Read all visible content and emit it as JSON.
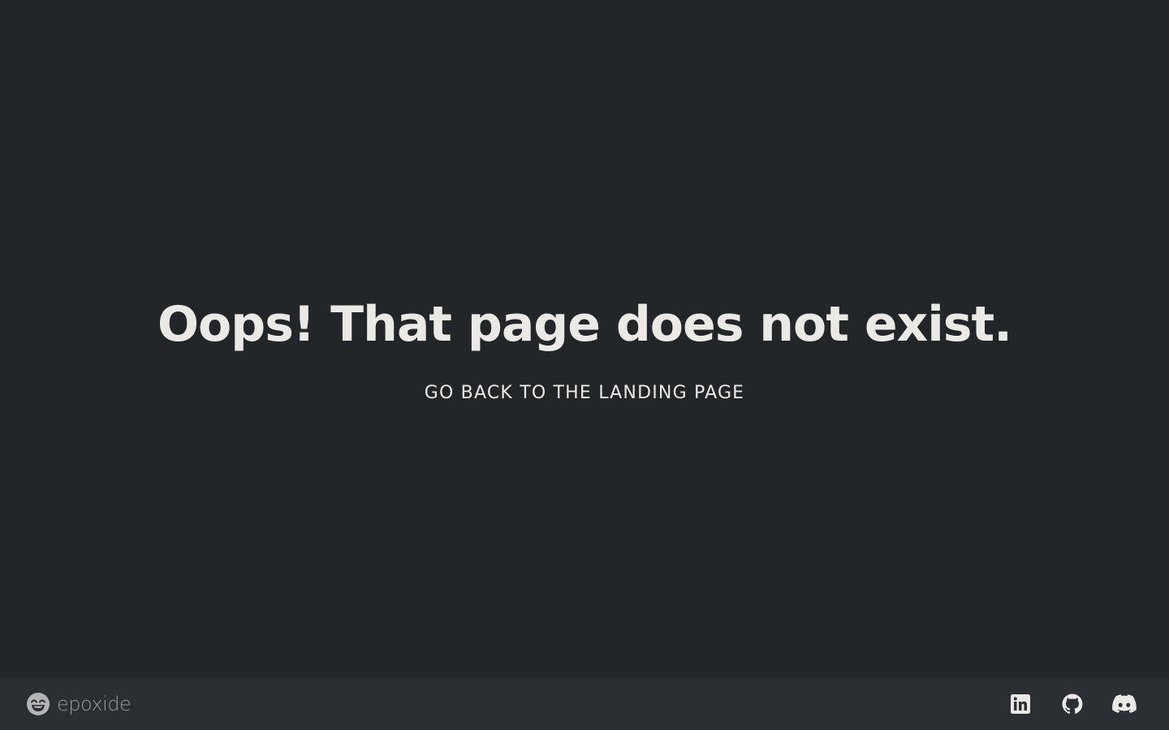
{
  "main": {
    "headline": "Oops! That page does not exist.",
    "back_link": "GO BACK TO THE LANDING PAGE"
  },
  "footer": {
    "brand_name": "epoxide",
    "brand_icon": "grinning-face-icon",
    "social_icons": [
      "linkedin-icon",
      "github-icon",
      "discord-icon"
    ]
  },
  "colors": {
    "background": "#232629",
    "footer_background": "#2b2e32",
    "text": "#ebe9e6",
    "muted": "#9b9b9b"
  }
}
